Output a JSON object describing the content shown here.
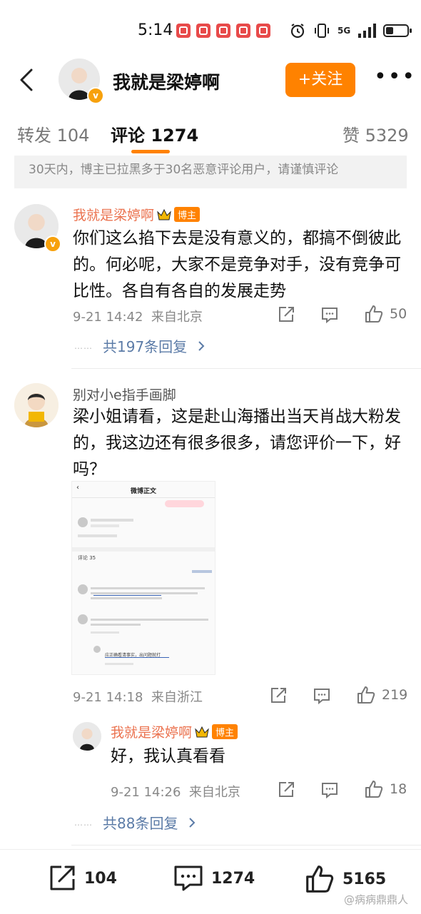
{
  "status_bar": {
    "time": "5:14",
    "network": "5G"
  },
  "header": {
    "title": "我就是梁婷啊",
    "follow_label": "+关注"
  },
  "tabs": [
    {
      "label": "转发 104"
    },
    {
      "label": "评论 1274"
    },
    {
      "label": "赞 5329"
    }
  ],
  "notice": "30天内，博主已拉黑多于30名恶意评论用户，请谨慎评论",
  "comments": [
    {
      "user": "我就是梁婷啊",
      "tag": "博主",
      "text": "你们这么掐下去是没有意义的，都搞不倒彼此的。何必呢，大家不是竞争对手，没有竞争可比性。各自有各自的发展走势",
      "time": "9-21 14:42",
      "location": "来自北京",
      "likes": "50",
      "replies_link": "共197条回复",
      "dots": "……"
    },
    {
      "user": "别对小e指手画脚",
      "text": "梁小姐请看，这是赴山海播出当天肖战大粉发的，我这边还有很多很多，请您评价一下，好吗？",
      "time": "9-21 14:18",
      "location": "来自浙江",
      "likes": "219",
      "embedded": {
        "title": "微博正文",
        "comments_label": "评论 35",
        "reply1": "应正确看清事实，出问题就打"
      },
      "reply": {
        "user": "我就是梁婷啊",
        "tag": "博主",
        "text": "好，我认真看看",
        "time": "9-21 14:26",
        "location": "来自北京",
        "likes": "18"
      },
      "replies_link": "共88条回复",
      "dots": "……"
    }
  ],
  "bottom_bar": {
    "reposts": "104",
    "comments": "1274",
    "likes": "5165"
  },
  "watermark": "@病病鼎鼎人",
  "colors": {
    "accent": "#ff8200",
    "name": "#eb7350",
    "link": "#5b7ba7"
  }
}
